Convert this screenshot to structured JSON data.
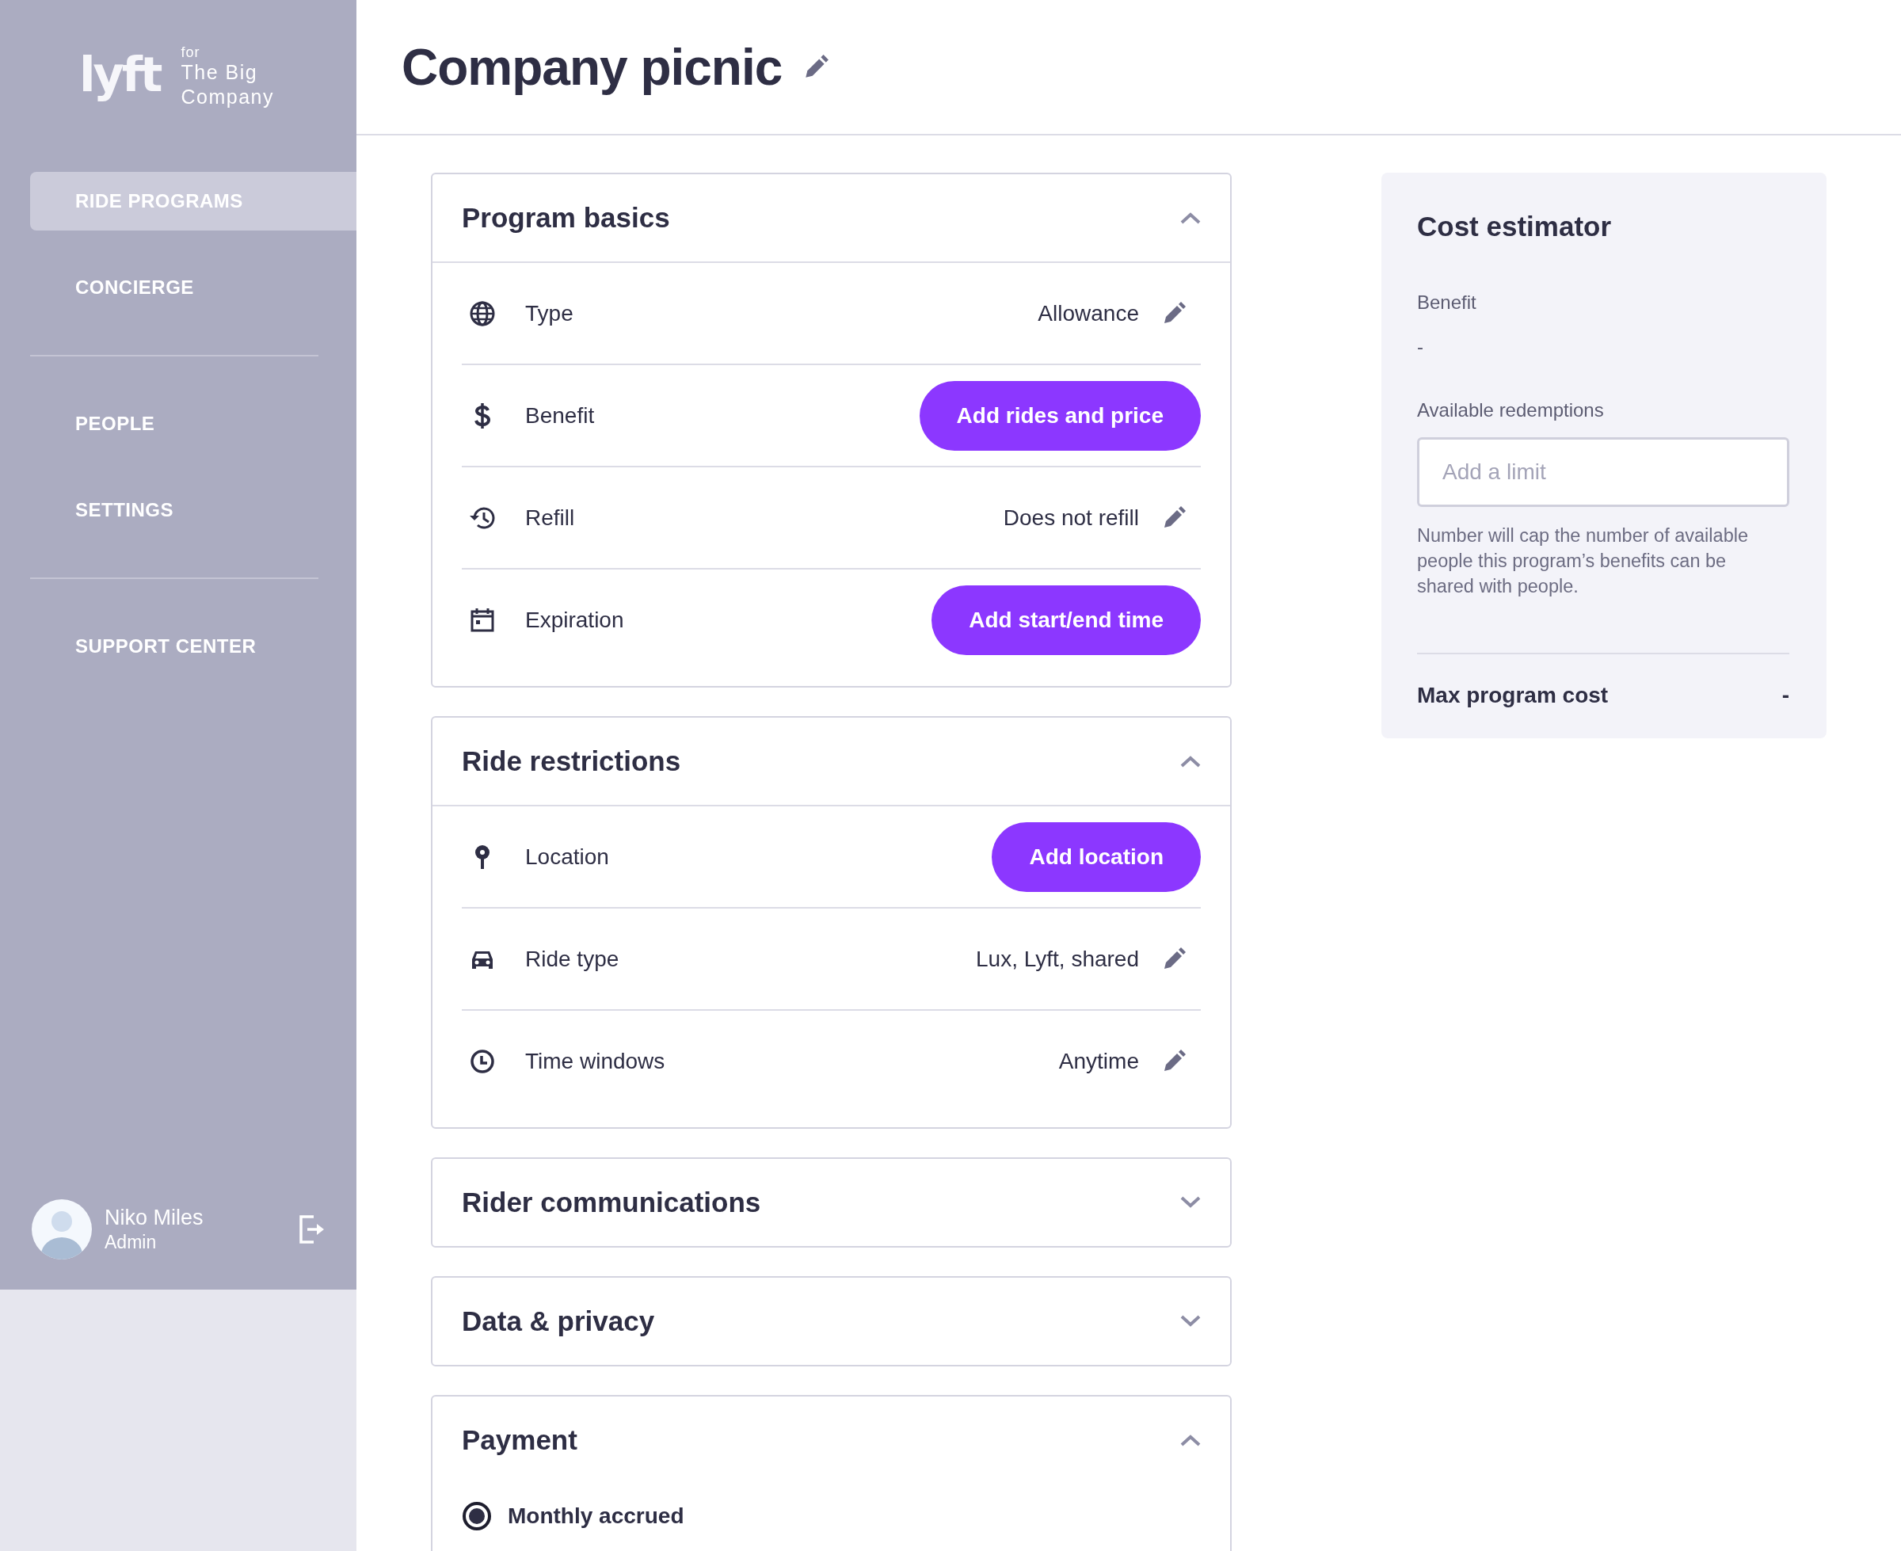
{
  "sidebar": {
    "logo": "lyft",
    "brand_prefix": "for",
    "brand_name": "The Big Company",
    "nav_groups": [
      [
        {
          "label": "RIDE PROGRAMS",
          "selected": true
        },
        {
          "label": "CONCIERGE",
          "selected": false
        }
      ],
      [
        {
          "label": "PEOPLE",
          "selected": false
        },
        {
          "label": "SETTINGS",
          "selected": false
        }
      ],
      [
        {
          "label": "SUPPORT CENTER",
          "selected": false
        }
      ]
    ],
    "user": {
      "name": "Niko Miles",
      "role": "Admin"
    }
  },
  "page_title": "Company picnic",
  "sections": [
    {
      "title": "Program basics",
      "expanded": true,
      "rows": [
        {
          "kind": "value",
          "label": "Type",
          "value": "Allowance"
        },
        {
          "kind": "button",
          "label": "Benefit",
          "action": "Add rides and price"
        },
        {
          "kind": "value",
          "label": "Refill",
          "value": "Does not refill"
        },
        {
          "kind": "button",
          "label": "Expiration",
          "action": "Add start/end time"
        }
      ]
    },
    {
      "title": "Ride restrictions",
      "expanded": true,
      "rows": [
        {
          "kind": "button",
          "label": "Location",
          "action": "Add location"
        },
        {
          "kind": "value",
          "label": "Ride type",
          "value": "Lux, Lyft, shared"
        },
        {
          "kind": "value",
          "label": "Time windows",
          "value": "Anytime"
        }
      ]
    },
    {
      "title": "Rider communications",
      "expanded": false
    },
    {
      "title": "Data & privacy",
      "expanded": false
    },
    {
      "title": "Payment",
      "expanded": true,
      "options": [
        {
          "label": "Monthly accrued",
          "selected": true
        }
      ]
    }
  ],
  "cost_estimator": {
    "title": "Cost estimator",
    "benefit_label": "Benefit",
    "benefit_value": "-",
    "redemptions_label": "Available redemptions",
    "placeholder": "Add a limit",
    "help": "Number will cap the number of available people this program’s benefits can be shared with people.",
    "max_label": "Max program cost",
    "max_value": "-"
  }
}
